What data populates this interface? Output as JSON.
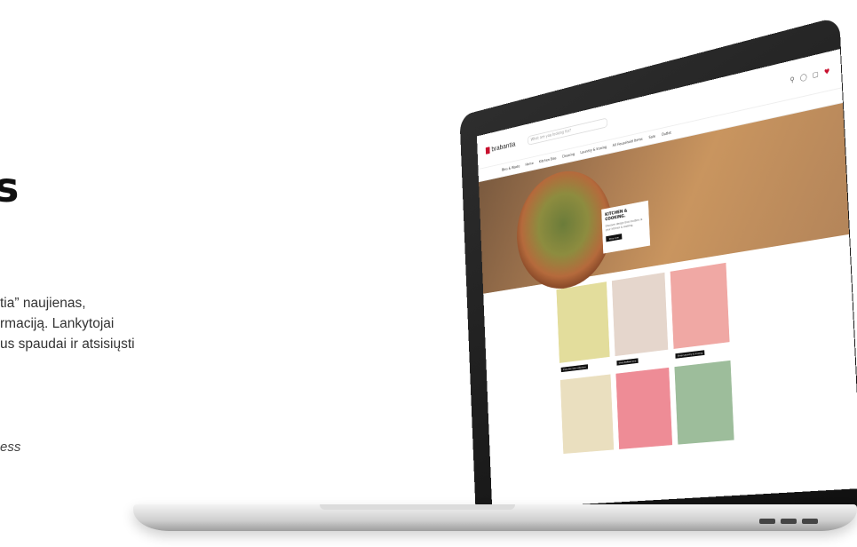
{
  "hero": {
    "heading_fragment": "s",
    "lines": [
      "tia” naujienas,",
      "rmaciją. Lankytojai",
      "us spaudai ir atsisiųsti"
    ],
    "caption_fragment": "ess"
  },
  "site": {
    "logo_text": "brabantia",
    "search_placeholder": "What are you looking for?",
    "nav_items": [
      "Bins & Waste",
      "Home",
      "Kitchen Bins",
      "Cleaning",
      "Laundry & Ironing",
      "All Household Items",
      "Sale",
      "Outlet"
    ],
    "banner": {
      "title": "KITCHEN & COOKING.",
      "text": "Discover design that matters in your kitchen & cooking.",
      "button": "Shop now"
    },
    "tiles": [
      {
        "color": "#e3dd9c",
        "button": "Shop the new collection"
      },
      {
        "color": "#e5d6cc",
        "button": "Shop ReNew bins"
      },
      {
        "color": "#f0a8a4",
        "button": "Shop Laundry & Ironing"
      },
      {
        "color": "#eadfbf",
        "button": ""
      },
      {
        "color": "#ee8c96",
        "button": ""
      },
      {
        "color": "#9dbd9b",
        "button": ""
      }
    ]
  }
}
